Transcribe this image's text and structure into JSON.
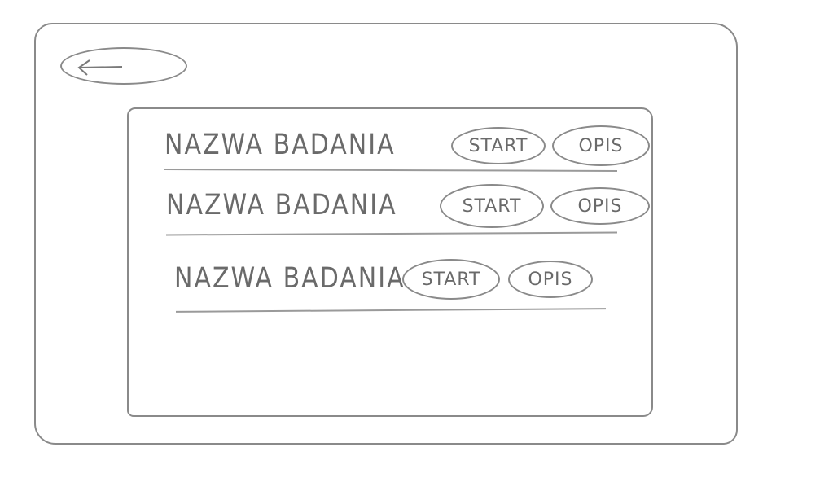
{
  "header": {
    "back_icon": "arrow-left-icon"
  },
  "studies": [
    {
      "name": "NAZWA BADANIA",
      "start_label": "START",
      "info_label": "OPIS"
    },
    {
      "name": "NAZWA BADANIA",
      "start_label": "START",
      "info_label": "OPIS"
    },
    {
      "name": "NAZWA BADANIA",
      "start_label": "START",
      "info_label": "OPIS"
    }
  ],
  "colors": {
    "pencil": "#8a8a8a",
    "background": "#ffffff"
  }
}
